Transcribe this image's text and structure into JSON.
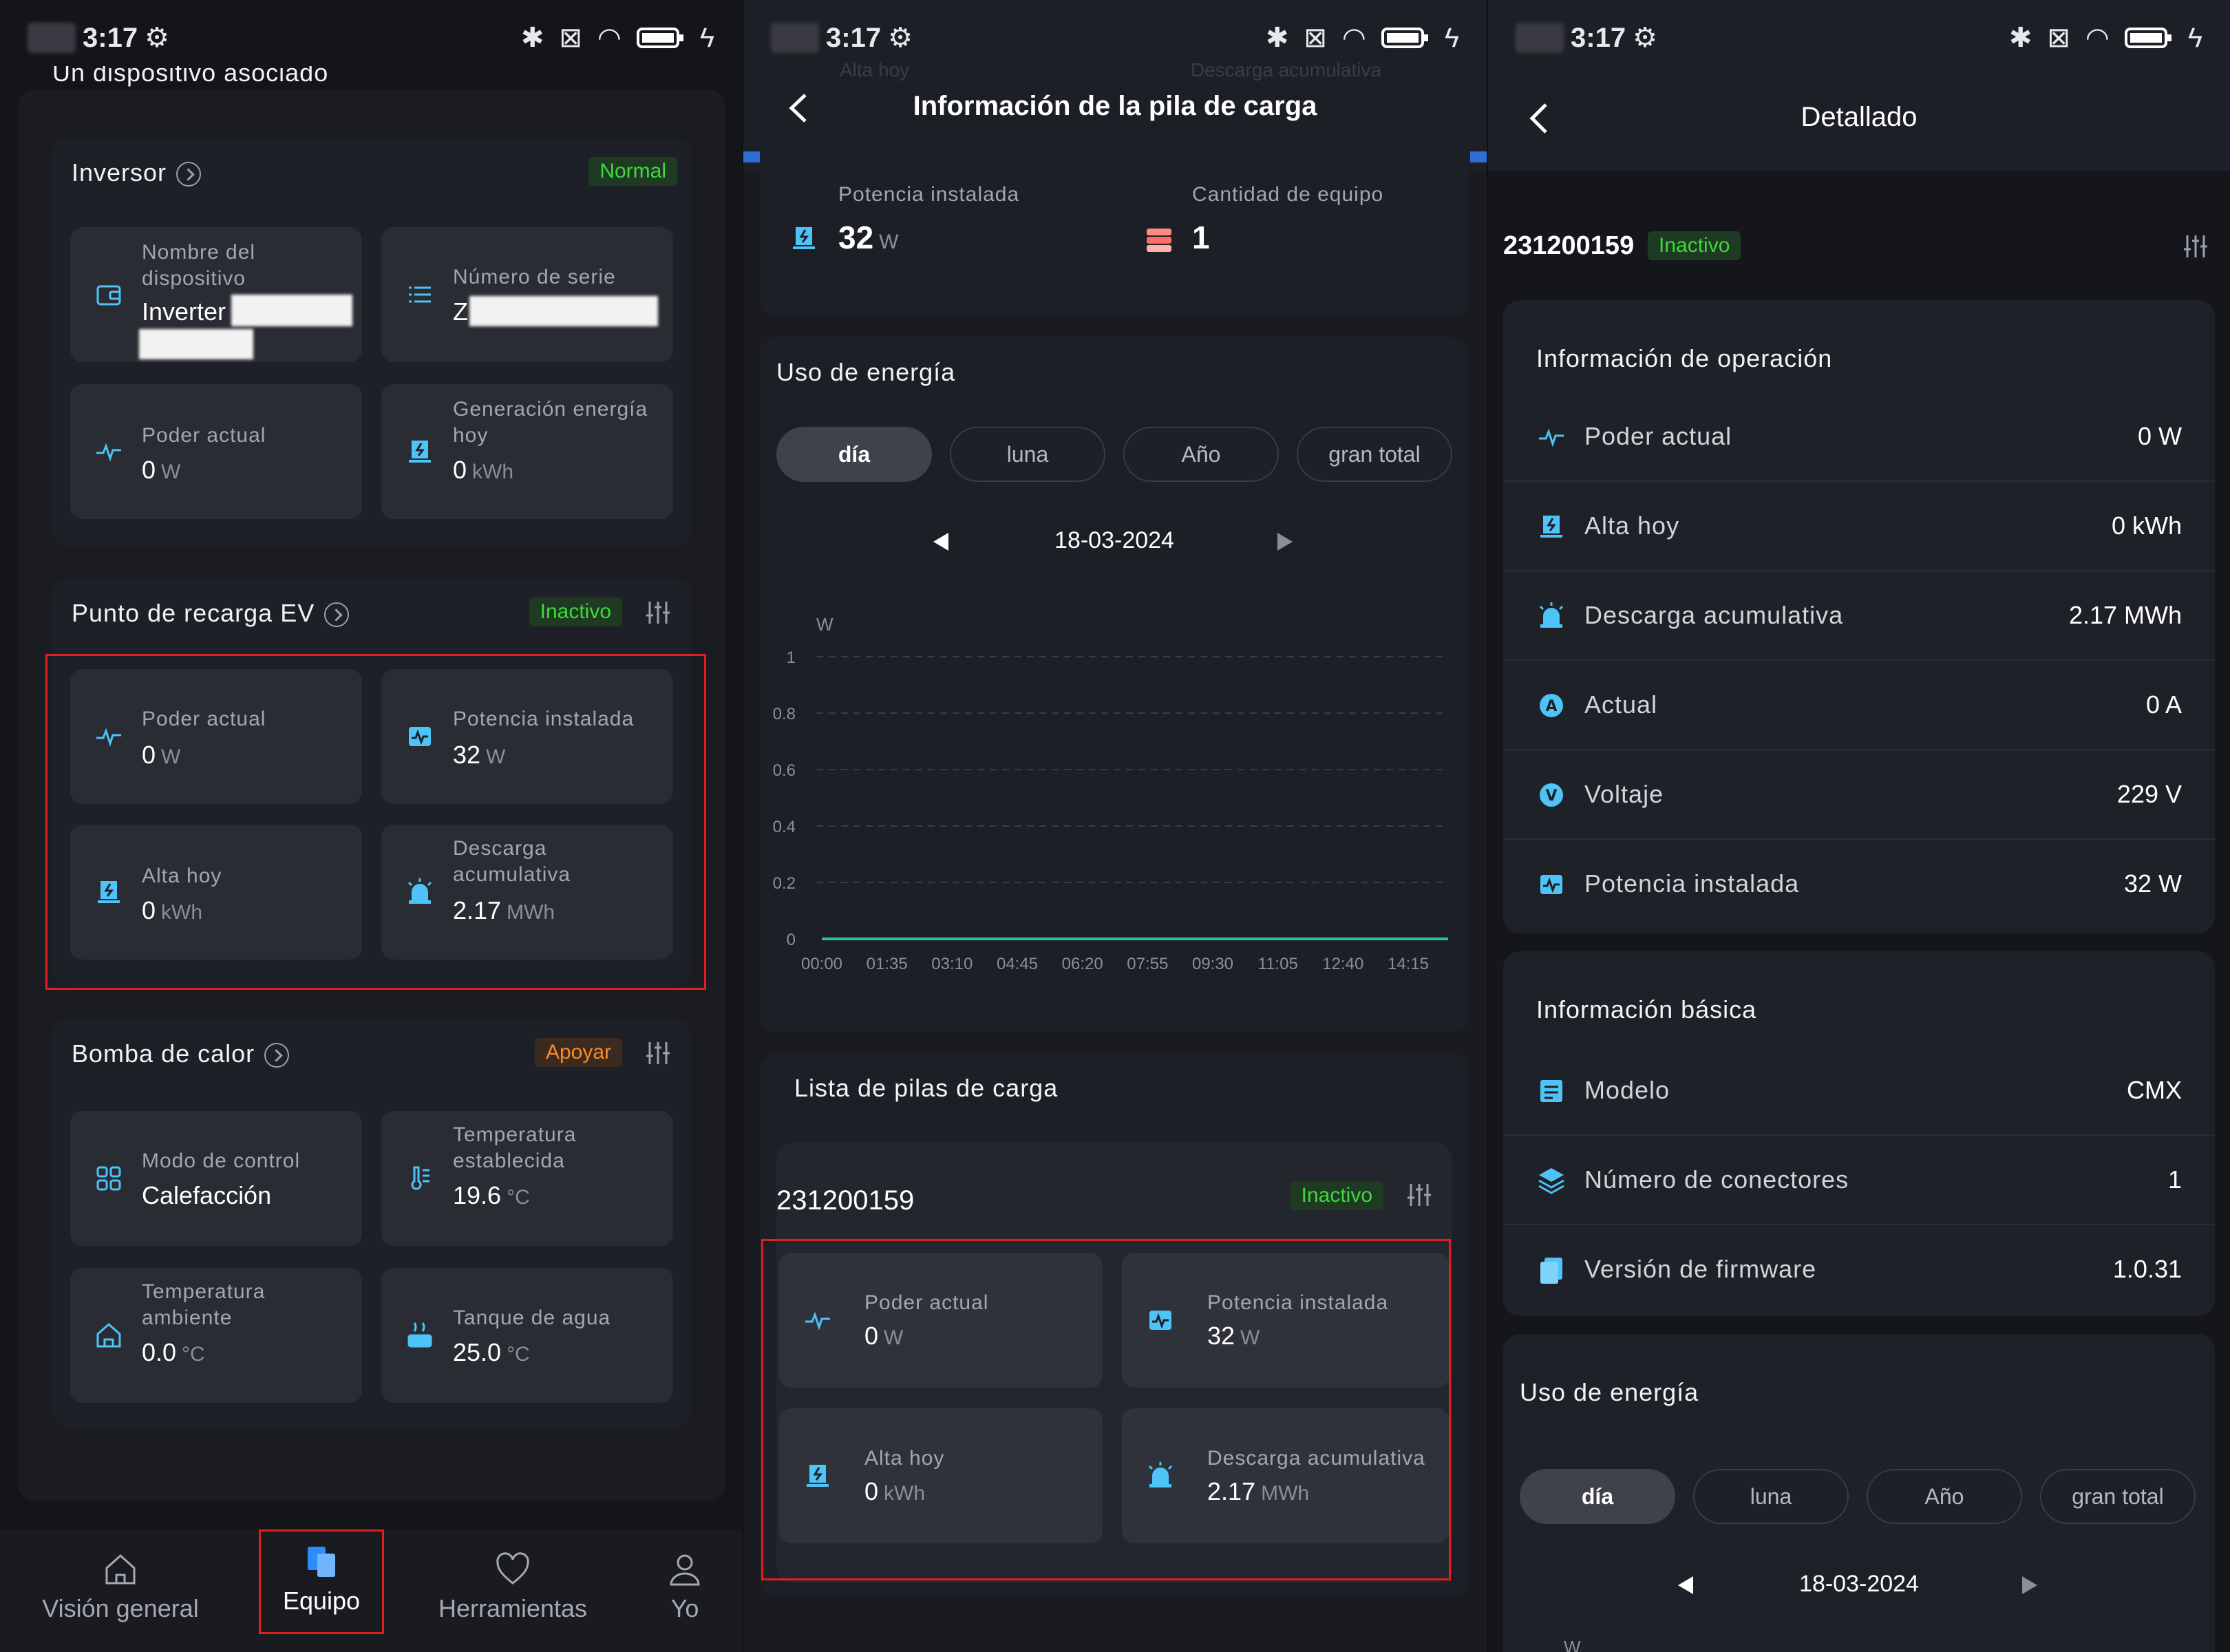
{
  "status": {
    "time": "3:17"
  },
  "panel1": {
    "cut_heading": "Un dispositivo asociado",
    "inverter": {
      "title": "Inversor",
      "badge": "Normal",
      "tiles": [
        {
          "label": "Nombre del dispositivo",
          "value": "Inverter",
          "unit": "",
          "icon": "wallet-icon"
        },
        {
          "label": "Número de serie",
          "value": "Z",
          "unit": "",
          "icon": "list-icon"
        },
        {
          "label": "Poder actual",
          "value": "0",
          "unit": "W",
          "icon": "pulse-icon"
        },
        {
          "label": "Generación energía hoy",
          "value": "0",
          "unit": "kWh",
          "icon": "power-today-icon"
        }
      ]
    },
    "ev": {
      "title": "Punto de recarga EV",
      "badge": "Inactivo",
      "tiles": [
        {
          "label": "Poder actual",
          "value": "0",
          "unit": "W"
        },
        {
          "label": "Potencia instalada",
          "value": "32",
          "unit": "W"
        },
        {
          "label": "Alta hoy",
          "value": "0",
          "unit": "kWh"
        },
        {
          "label": "Descarga acumulativa",
          "value": "2.17",
          "unit": "MWh"
        }
      ]
    },
    "heatpump": {
      "title": "Bomba de calor",
      "badge": "Apoyar",
      "tiles": [
        {
          "label": "Modo de control",
          "value": "Calefacción",
          "unit": ""
        },
        {
          "label": "Temperatura establecida",
          "value": "19.6",
          "unit": "°C"
        },
        {
          "label": "Temperatura ambiente",
          "value": "0.0",
          "unit": "°C"
        },
        {
          "label": "Tanque de agua",
          "value": "25.0",
          "unit": "°C"
        }
      ]
    },
    "nav": [
      {
        "label": "Visión general"
      },
      {
        "label": "Equipo"
      },
      {
        "label": "Herramientas"
      },
      {
        "label": "Yo"
      }
    ]
  },
  "panel2": {
    "header_title": "Información de la pila de carga",
    "ghost_left": "Alta hoy",
    "ghost_right": "Descarga acumulativa",
    "installed_label": "Potencia instalada",
    "installed_value": "32",
    "installed_unit": "W",
    "equip_label": "Cantidad de equipo",
    "equip_value": "1",
    "energy_title": "Uso de energía",
    "tabs": [
      "día",
      "luna",
      "Año",
      "gran total"
    ],
    "date": "18-03-2024",
    "list_title": "Lista de pilas de carga",
    "serial": "231200159",
    "serial_badge": "Inactivo",
    "tiles": [
      {
        "label": "Poder actual",
        "value": "0",
        "unit": "W"
      },
      {
        "label": "Potencia instalada",
        "value": "32",
        "unit": "W"
      },
      {
        "label": "Alta hoy",
        "value": "0",
        "unit": "kWh"
      },
      {
        "label": "Descarga acumulativa",
        "value": "2.17",
        "unit": "MWh"
      }
    ]
  },
  "chart_data": {
    "type": "line",
    "ylabel": "W",
    "ylim": [
      0,
      1
    ],
    "yticks": [
      "1",
      "0.8",
      "0.6",
      "0.4",
      "0.2",
      "0"
    ],
    "x": [
      "00:00",
      "01:35",
      "03:10",
      "04:45",
      "06:20",
      "07:55",
      "09:30",
      "11:05",
      "12:40",
      "14:15"
    ],
    "series": [
      {
        "values": [
          0,
          0,
          0,
          0,
          0,
          0,
          0,
          0,
          0,
          0
        ],
        "color": "#2fbf9c"
      }
    ],
    "grid": true
  },
  "panel3": {
    "header_title": "Detallado",
    "serial": "231200159",
    "badge": "Inactivo",
    "op_title": "Información de operación",
    "op_rows": [
      {
        "label": "Poder actual",
        "value": "0 W"
      },
      {
        "label": "Alta hoy",
        "value": "0 kWh"
      },
      {
        "label": "Descarga acumulativa",
        "value": "2.17 MWh"
      },
      {
        "label": "Actual",
        "value": "0 A"
      },
      {
        "label": "Voltaje",
        "value": "229 V"
      },
      {
        "label": "Potencia instalada",
        "value": "32 W"
      }
    ],
    "basic_title": "Información básica",
    "basic_rows": [
      {
        "label": "Modelo",
        "value": "CMX"
      },
      {
        "label": "Número de conectores",
        "value": "1"
      },
      {
        "label": "Versión de firmware",
        "value": "1.0.31"
      }
    ],
    "energy_title": "Uso de energía",
    "tabs": [
      "día",
      "luna",
      "Año",
      "gran total"
    ],
    "date": "18-03-2024",
    "ylabel": "W"
  },
  "colors": {
    "accent": "#4ec3f7",
    "green": "#3fd93b",
    "orange": "#ff8a24",
    "red_box": "#e02020"
  }
}
